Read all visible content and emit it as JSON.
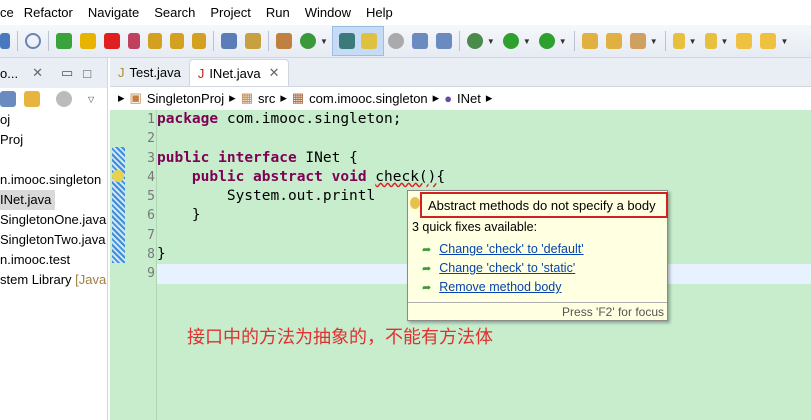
{
  "menu": [
    "ce",
    "Refactor",
    "Navigate",
    "Search",
    "Project",
    "Run",
    "Window",
    "Help"
  ],
  "left_panel": {
    "tab_label": "o...",
    "tree": [
      {
        "label": "oj"
      },
      {
        "label": "Proj"
      },
      {
        "label": ""
      },
      {
        "label": "n.imooc.singleton"
      },
      {
        "label": "INet.java",
        "selected": true
      },
      {
        "label": "SingletonOne.java"
      },
      {
        "label": "SingletonTwo.java"
      },
      {
        "label": "n.imooc.test"
      },
      {
        "label": "stem Library",
        "suffix": "[Java"
      }
    ]
  },
  "editor": {
    "tabs": [
      {
        "label": "Test.java",
        "active": false
      },
      {
        "label": "INet.java",
        "active": true
      }
    ],
    "breadcrumb": [
      "SingletonProj",
      "src",
      "com.imooc.singleton",
      "INet"
    ],
    "line_numbers": [
      "1",
      "2",
      "3",
      "4",
      "5",
      "6",
      "7",
      "8",
      "9"
    ],
    "code": {
      "l1_kw": "package",
      "l1_rest": " com.imooc.singleton;",
      "l3_kw1": "public",
      "l3_kw2": "interface",
      "l3_rest": " INet {",
      "l4_kw1": "public",
      "l4_kw2": "abstract",
      "l4_kw3": "void",
      "l4_err": "check()",
      "l4_rest": "{",
      "l5": "        System.out.printl",
      "l6": "    }",
      "l8": "}"
    }
  },
  "quickfix": {
    "error": "Abstract methods do not specify a body",
    "count": "3 quick fixes available:",
    "fixes": [
      "Change 'check' to 'default'",
      "Change 'check' to 'static'",
      "Remove method body"
    ],
    "footer": "Press 'F2' for focus"
  },
  "annotation": "接口中的方法为抽象的，不能有方法体",
  "colors": {
    "editor_bg": "#c7edcc",
    "error": "#d32020",
    "keyword": "#7f0055",
    "link": "#0645ad"
  }
}
